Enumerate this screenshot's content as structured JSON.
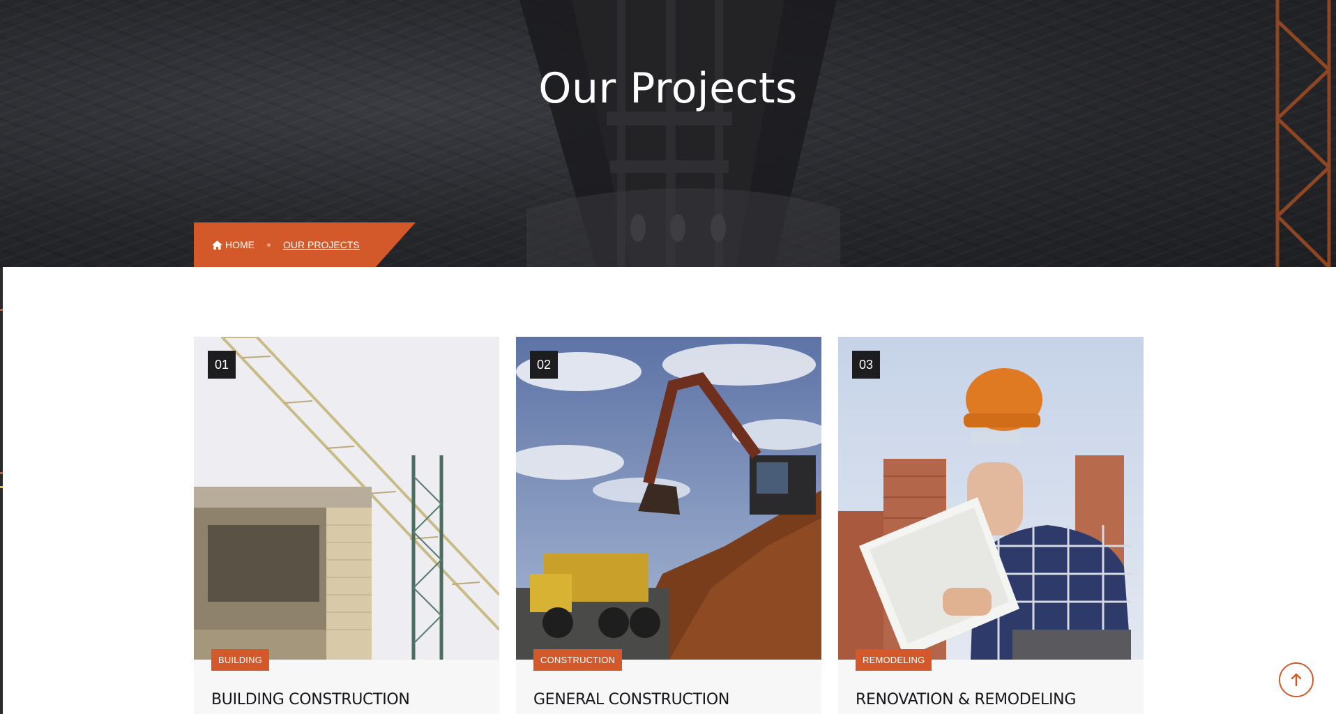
{
  "hero": {
    "title": "Our Projects"
  },
  "breadcrumb": {
    "home_label": "HOME",
    "current_label": "OUR PROJECTS"
  },
  "projects": [
    {
      "number": "01",
      "tag": "BUILDING",
      "title": "BUILDING CONSTRUCTION",
      "image": "crane-building-photo"
    },
    {
      "number": "02",
      "tag": "CONSTRUCTION",
      "title": "GENERAL CONSTRUCTION",
      "image": "excavator-photo"
    },
    {
      "number": "03",
      "tag": "REMODELING",
      "title": "RENOVATION & REMODELING",
      "image": "worker-blueprint-photo"
    }
  ],
  "icons": {
    "home": "home-icon",
    "scroll_top": "arrow-up-icon"
  },
  "colors": {
    "accent": "#d4592a",
    "dark": "#1d1d20",
    "hero_bg": "#26272b"
  }
}
